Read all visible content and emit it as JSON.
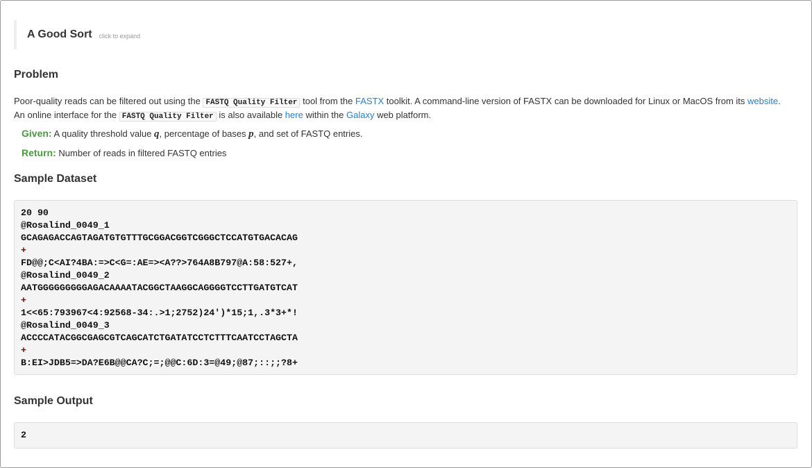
{
  "header": {
    "title": "A Good Sort",
    "expand_hint": "click to expand"
  },
  "problem": {
    "heading": "Problem",
    "p1_a": "Poor-quality reads can be filtered out using the ",
    "code1": "FASTQ Quality Filter",
    "p1_b": " tool from the ",
    "link_fastx": "FASTX",
    "p1_c": " toolkit. A command-line version of FASTX can be downloaded for Linux or MacOS from its ",
    "link_website": "website",
    "p1_d": ".",
    "p2_a": "An online interface for the ",
    "code2": "FASTQ Quality Filter",
    "p2_b": " is also available ",
    "link_here": "here",
    "p2_c": " within the ",
    "link_galaxy": "Galaxy",
    "p2_d": " web platform.",
    "given_label": "Given:",
    "given_a": " A quality threshold value ",
    "var_q": "q",
    "given_b": ", percentage of bases ",
    "var_p": "p",
    "given_c": ", and set of FASTQ entries.",
    "return_label": "Return:",
    "return_text": " Number of reads in filtered FASTQ entries"
  },
  "sample_dataset": {
    "heading": "Sample Dataset",
    "lines": [
      "20 90",
      "@Rosalind_0049_1",
      "GCAGAGACCAGTAGATGTGTTTGCGGACGGTCGGGCTCCATGTGACACAG",
      "+",
      "FD@@;C<AI?4BA:=>C<G=:AE=><A??>764A8B797@A:58:527+,",
      "@Rosalind_0049_2",
      "AATGGGGGGGGGAGACAAAATACGGCTAAGGCAGGGGTCCTTGATGTCAT",
      "+",
      "1<<65:793967<4:92568-34:.>1;2752)24')*15;1,.3*3+*!",
      "@Rosalind_0049_3",
      "ACCCCATACGGCGAGCGTCAGCATCTGATATCCTCTTTCAATCCTAGCTA",
      "+",
      "B:EI>JDB5=>DA?E6B@@CA?C;=;@@C:6D:3=@49;@87;::;;?8+"
    ]
  },
  "sample_output": {
    "heading": "Sample Output",
    "value": "2"
  }
}
